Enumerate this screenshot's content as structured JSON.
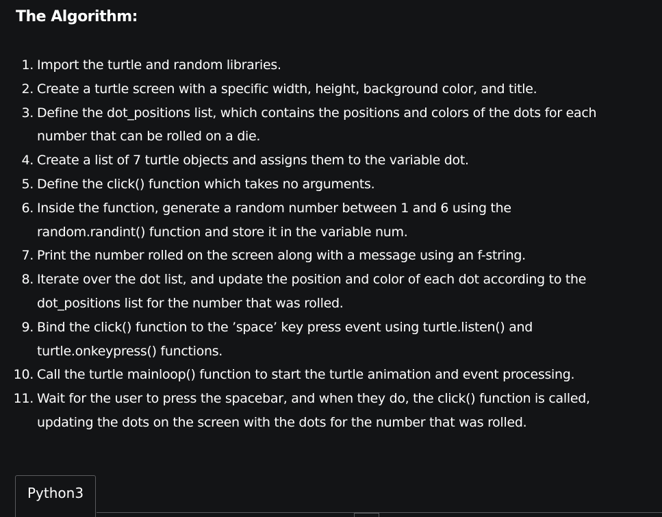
{
  "heading": "The Algorithm:",
  "steps": [
    {
      "num": "1.",
      "lines": [
        "Import the turtle and random libraries."
      ]
    },
    {
      "num": "2.",
      "lines": [
        "Create a turtle screen with a specific width, height, background color, and title."
      ]
    },
    {
      "num": "3.",
      "lines": [
        "Define the dot_positions list, which contains the positions and colors of the dots for each",
        "number that can be rolled on a die."
      ]
    },
    {
      "num": "4.",
      "lines": [
        "Create a list of 7 turtle objects and assigns them to the variable dot."
      ]
    },
    {
      "num": "5.",
      "lines": [
        "Define the click() function which takes no arguments."
      ]
    },
    {
      "num": "6.",
      "lines": [
        "Inside the function, generate a random number between 1 and 6 using the",
        "random.randint() function and store it in the variable num."
      ]
    },
    {
      "num": "7.",
      "lines": [
        "Print the number rolled on the screen along with a message using an f-string."
      ]
    },
    {
      "num": "8.",
      "lines": [
        "Iterate over the dot list, and update the position and color of each dot according to the",
        "dot_positions list for the number that was rolled."
      ]
    },
    {
      "num": "9.",
      "lines": [
        "Bind the click() function to the ’space’ key press event using turtle.listen() and",
        "turtle.onkeypress() functions."
      ]
    },
    {
      "num": "10.",
      "lines": [
        "Call the turtle mainloop() function to start the turtle animation and event processing."
      ]
    },
    {
      "num": "11.",
      "lines": [
        "Wait for the user to press the spacebar, and when they do, the click() function is called,",
        "updating the dots on the screen with the dots for the number that was rolled."
      ]
    }
  ],
  "code_tab": {
    "label": "Python3"
  }
}
